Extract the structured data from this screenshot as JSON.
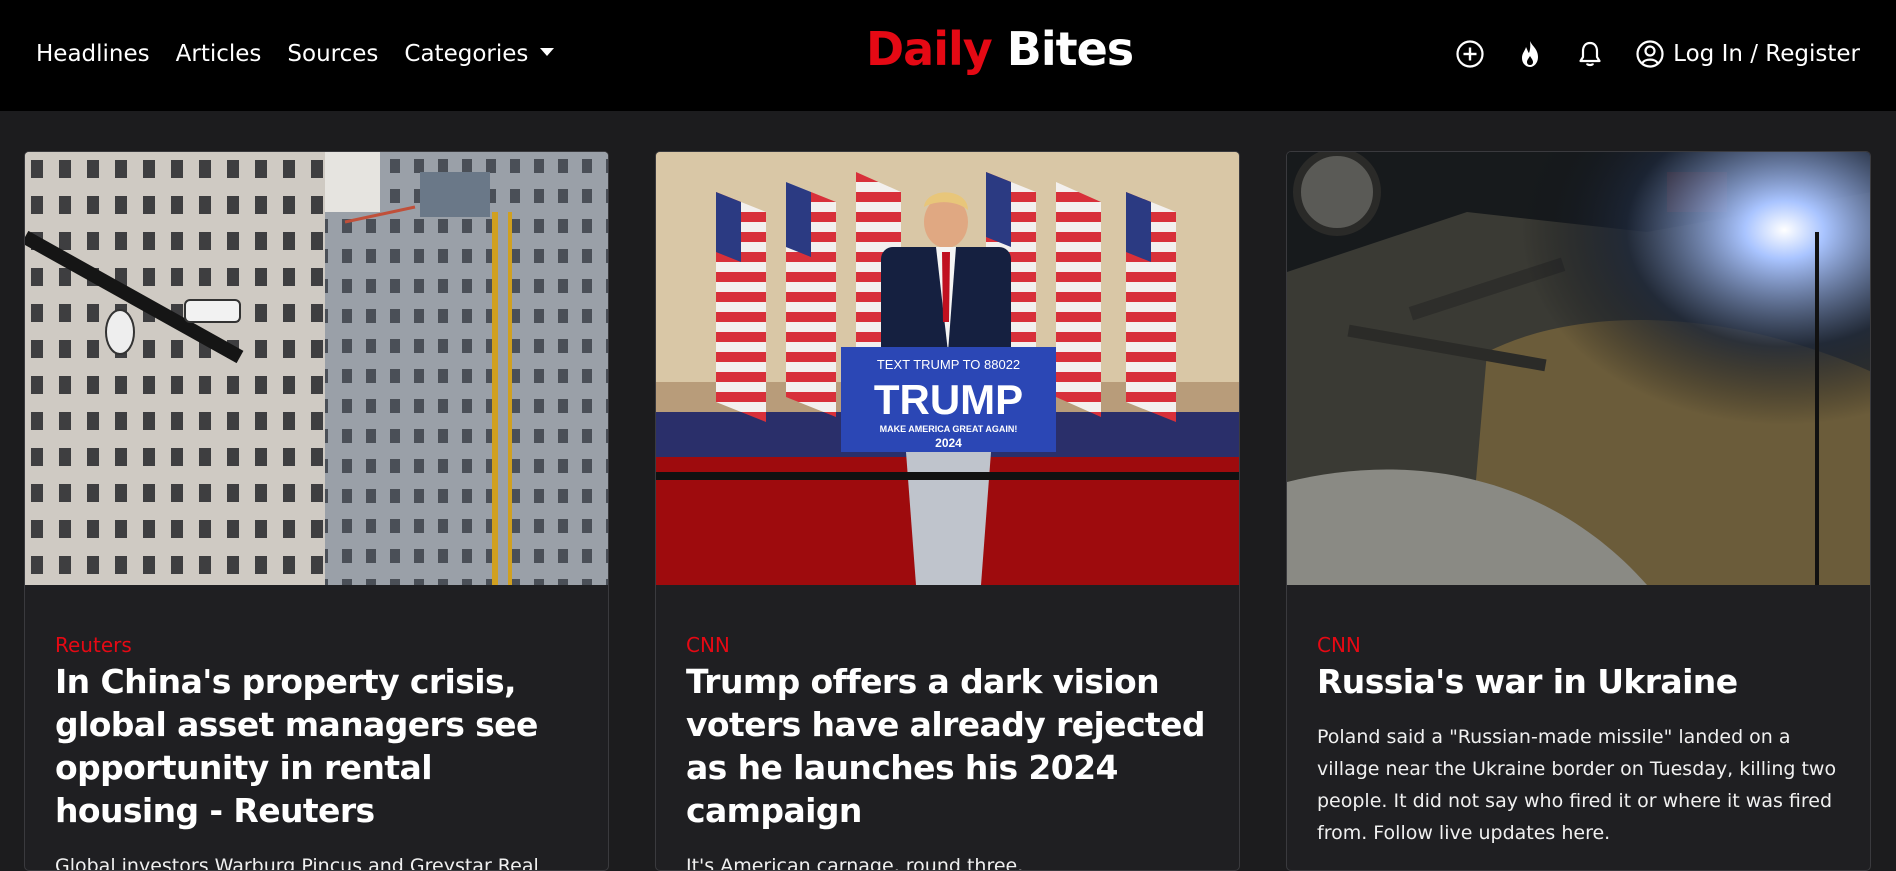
{
  "nav": {
    "links": [
      "Headlines",
      "Articles",
      "Sources",
      "Categories"
    ],
    "brand_part1": "Daily",
    "brand_part2": "Bites",
    "login_label": "Log In / Register"
  },
  "colors": {
    "accent": "#e50914",
    "navbar": "#000000",
    "background": "#1c1c1e",
    "card": "#1f1f22"
  },
  "icons": [
    "plus-circle-icon",
    "fire-icon",
    "bell-icon",
    "user-circle-icon",
    "chevron-down-icon"
  ],
  "cards": [
    {
      "source": "Reuters",
      "title": "In China's property crisis, global asset managers see opportunity in rental housing - Reuters",
      "description": "Global investors Warburg Pincus and Greystar Real Estate Partners are pushing deeper into China's rental"
    },
    {
      "source": "CNN",
      "title": "Trump offers a dark vision voters have already rejected as he launches his 2024 campaign",
      "description": "It's American carnage, round three.",
      "image_text": {
        "line1": "TEXT TRUMP TO 88022",
        "line2": "TRUMP",
        "line3": "MAKE AMERICA GREAT AGAIN!",
        "line4": "2024"
      }
    },
    {
      "source": "CNN",
      "title": "Russia's war in Ukraine",
      "description": "Poland said a \"Russian-made missile\" landed on a village near the Ukraine border on Tuesday, killing two people. It did not say who fired it or where it was fired from. Follow live updates here."
    }
  ]
}
